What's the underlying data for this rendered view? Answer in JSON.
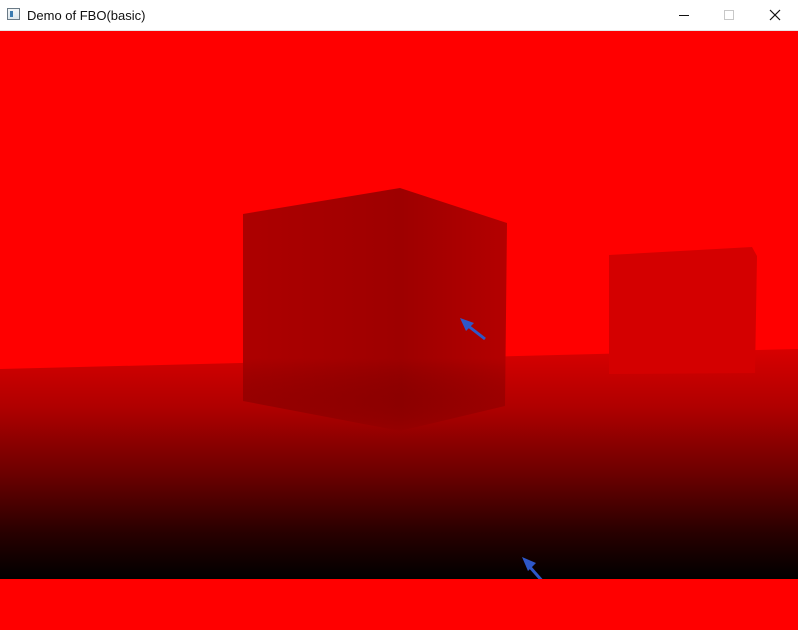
{
  "window": {
    "title": "Demo of FBO(basic)",
    "icon": "console-app-icon",
    "controls": {
      "minimize_icon": "minimize-icon",
      "maximize_icon": "maximize-icon",
      "close_icon": "close-icon"
    }
  },
  "scene": {
    "background_color": "#ff0000",
    "floor_gradient": [
      "#d00000",
      "#000000"
    ],
    "objects": [
      {
        "name": "large-cube",
        "color": "#a80000"
      },
      {
        "name": "small-cube",
        "color": "#d40000"
      }
    ],
    "annotation_color": "#2e57c8"
  }
}
